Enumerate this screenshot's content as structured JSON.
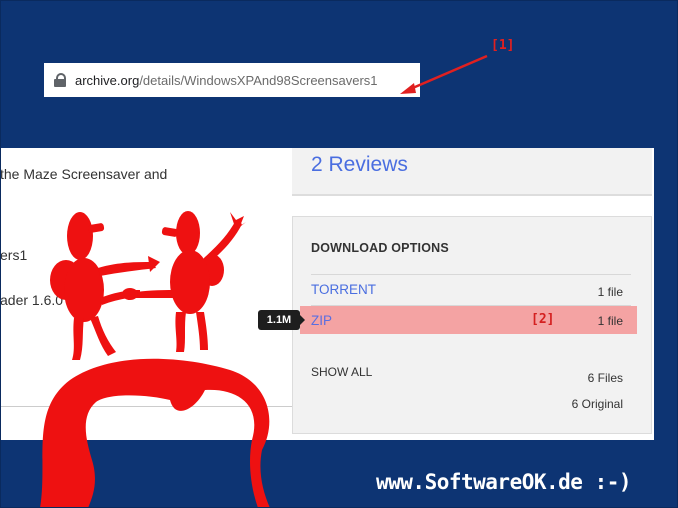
{
  "address_bar": {
    "host": "archive.org",
    "path": "/details/WindowsXPAnd98Screensavers1"
  },
  "annotations": {
    "marker_1": "[1]",
    "marker_2": "[2]"
  },
  "left_text": {
    "line1": "the Maze Screensaver and",
    "line2": "ers1",
    "line3": "ader 1.6.0"
  },
  "reviews": {
    "label": "2 Reviews"
  },
  "download_options": {
    "title": "DOWNLOAD OPTIONS",
    "torrent": {
      "label": "TORRENT",
      "count": "1 file"
    },
    "zip": {
      "label": "ZIP",
      "count": "1 file",
      "size": "1.1M"
    },
    "show_all": {
      "label": "SHOW ALL",
      "files": "6 Files",
      "original": "6 Original"
    }
  },
  "watermark": "www.SoftwareOK.de :-)",
  "colors": {
    "background": "#0d3473",
    "link": "#4a6ee0",
    "highlight": "#f4a3a3",
    "annotation": "#e02020"
  }
}
